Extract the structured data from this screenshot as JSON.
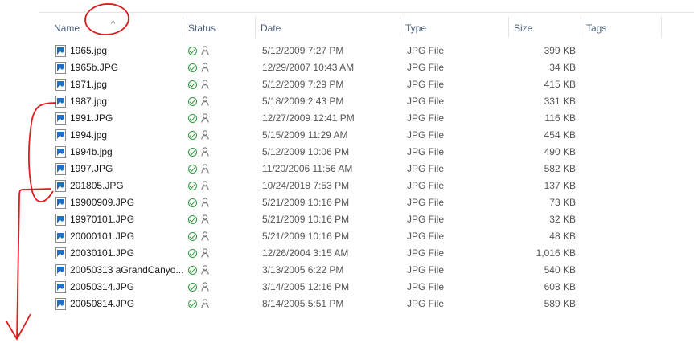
{
  "columns": {
    "name": "Name",
    "status": "Status",
    "date": "Date",
    "type": "Type",
    "size": "Size",
    "tags": "Tags"
  },
  "sort_indicator": "^",
  "files": [
    {
      "name": "1965.jpg",
      "date": "5/12/2009 7:27 PM",
      "type": "JPG File",
      "size": "399 KB"
    },
    {
      "name": "1965b.JPG",
      "date": "12/29/2007 10:43 AM",
      "type": "JPG File",
      "size": "34 KB"
    },
    {
      "name": "1971.jpg",
      "date": "5/12/2009 7:29 PM",
      "type": "JPG File",
      "size": "415 KB"
    },
    {
      "name": "1987.jpg",
      "date": "5/18/2009 2:43 PM",
      "type": "JPG File",
      "size": "331 KB"
    },
    {
      "name": "1991.JPG",
      "date": "12/27/2009 12:41 PM",
      "type": "JPG File",
      "size": "116 KB"
    },
    {
      "name": "1994.jpg",
      "date": "5/15/2009 11:29 AM",
      "type": "JPG File",
      "size": "454 KB"
    },
    {
      "name": "1994b.jpg",
      "date": "5/12/2009 10:06 PM",
      "type": "JPG File",
      "size": "490 KB"
    },
    {
      "name": "1997.JPG",
      "date": "11/20/2006 11:56 AM",
      "type": "JPG File",
      "size": "582 KB"
    },
    {
      "name": "201805.JPG",
      "date": "10/24/2018 7:53 PM",
      "type": "JPG File",
      "size": "137 KB"
    },
    {
      "name": "19900909.JPG",
      "date": "5/21/2009 10:16 PM",
      "type": "JPG File",
      "size": "73 KB"
    },
    {
      "name": "19970101.JPG",
      "date": "5/21/2009 10:16 PM",
      "type": "JPG File",
      "size": "32 KB"
    },
    {
      "name": "20000101.JPG",
      "date": "5/21/2009 10:16 PM",
      "type": "JPG File",
      "size": "48 KB"
    },
    {
      "name": "20030101.JPG",
      "date": "12/26/2004 3:15 AM",
      "type": "JPG File",
      "size": "1,016 KB"
    },
    {
      "name": "20050313 aGrandCanyo...",
      "date": "3/13/2005 6:22 PM",
      "type": "JPG File",
      "size": "540 KB"
    },
    {
      "name": "20050314.JPG",
      "date": "3/14/2005 12:16 PM",
      "type": "JPG File",
      "size": "608 KB"
    },
    {
      "name": "20050814.JPG",
      "date": "8/14/2005 5:51 PM",
      "type": "JPG File",
      "size": "589 KB"
    }
  ],
  "status_icons": [
    "synced-check-icon",
    "shared-person-icon"
  ],
  "colors": {
    "header_text": "#4c607a",
    "status_green": "#2e9a3a",
    "annotation_red": "#e01c1c",
    "file_icon_blue": "#1f6fc5"
  }
}
